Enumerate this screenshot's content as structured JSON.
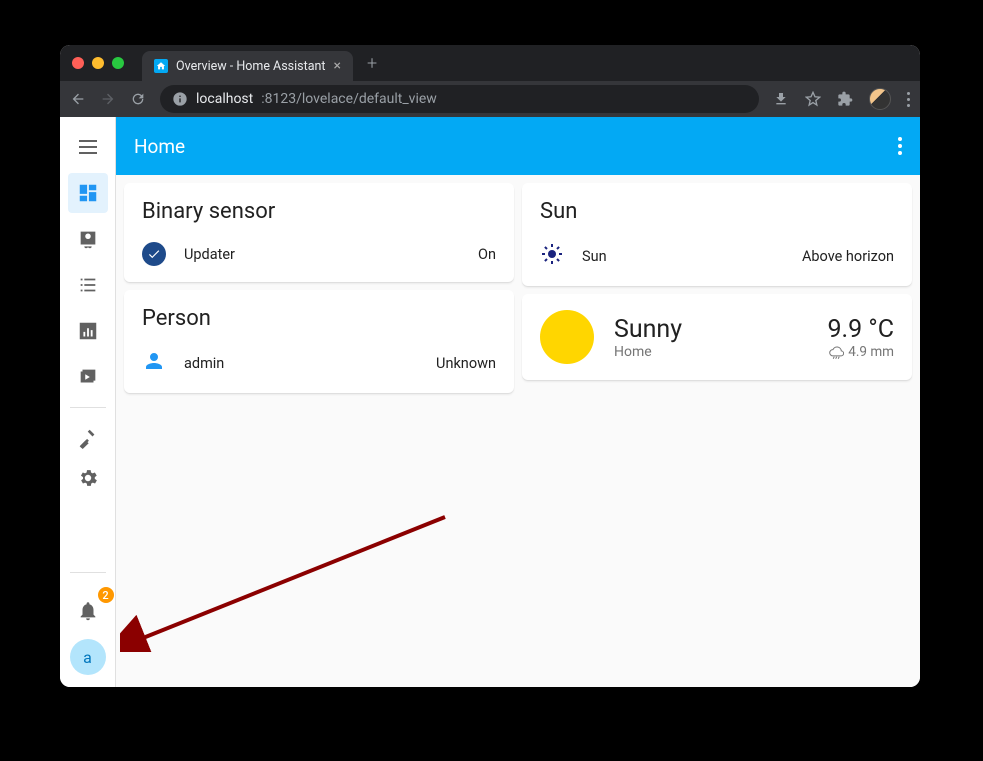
{
  "browser": {
    "tab_title": "Overview - Home Assistant",
    "url_host": "localhost",
    "url_path": ":8123/lovelace/default_view"
  },
  "header": {
    "title": "Home"
  },
  "sidebar": {
    "notifications_count": "2",
    "user_initial": "a"
  },
  "cards": {
    "binary_sensor": {
      "title": "Binary sensor",
      "item_name": "Updater",
      "item_state": "On"
    },
    "person": {
      "title": "Person",
      "item_name": "admin",
      "item_state": "Unknown"
    },
    "sun": {
      "title": "Sun",
      "item_name": "Sun",
      "item_state": "Above horizon"
    },
    "weather": {
      "condition": "Sunny",
      "location": "Home",
      "temperature": "9.9 °C",
      "precipitation": "4.9 mm"
    }
  }
}
